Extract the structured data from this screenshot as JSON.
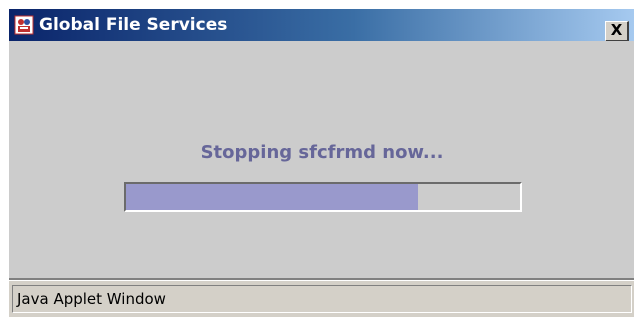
{
  "window": {
    "title": "Global File Services",
    "close_label": "X",
    "icon": "java-applet-icon"
  },
  "main": {
    "status_message": "Stopping sfcfrmd now...",
    "progress_fraction": 0.74
  },
  "statusbar": {
    "text": "Java Applet Window"
  },
  "colors": {
    "title_gradient_start": "#0a246a",
    "title_gradient_end": "#a6caf0",
    "status_text": "#666699",
    "progress_fill": "#9999cc",
    "content_bg": "#cccccc"
  }
}
